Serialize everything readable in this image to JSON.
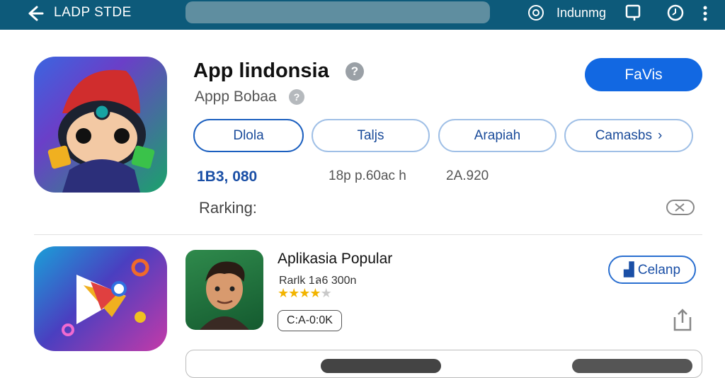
{
  "topbar": {
    "store_name": "LADP STDE",
    "user_name": "Indunmg",
    "icons": [
      "back-arrow-icon",
      "camera-icon",
      "cast-icon",
      "clock-icon",
      "more-vert-icon"
    ]
  },
  "app": {
    "title": "App lindonsia",
    "subtitle": "Appp Bobaa",
    "fav_button": "FaVis",
    "chips": [
      {
        "label": "Dlola"
      },
      {
        "label": "Taljs"
      },
      {
        "label": "Arapiah"
      },
      {
        "label": "Camasbs"
      }
    ],
    "stats": [
      "1Β3, 080",
      "18p p.60ac h",
      "2Α.920"
    ],
    "ranking_label": "Rarking:"
  },
  "popular": {
    "title": "Aplikasia Popular",
    "subtitle": "Rarlk 1ล6 300n",
    "rating": 4,
    "rating_max": 5,
    "price": "C:A-0:0K",
    "get_button": "Celanp"
  },
  "colors": {
    "topbar": "#0d5a7a",
    "primary": "#1268e2",
    "chip_text": "#1a4b9a"
  }
}
